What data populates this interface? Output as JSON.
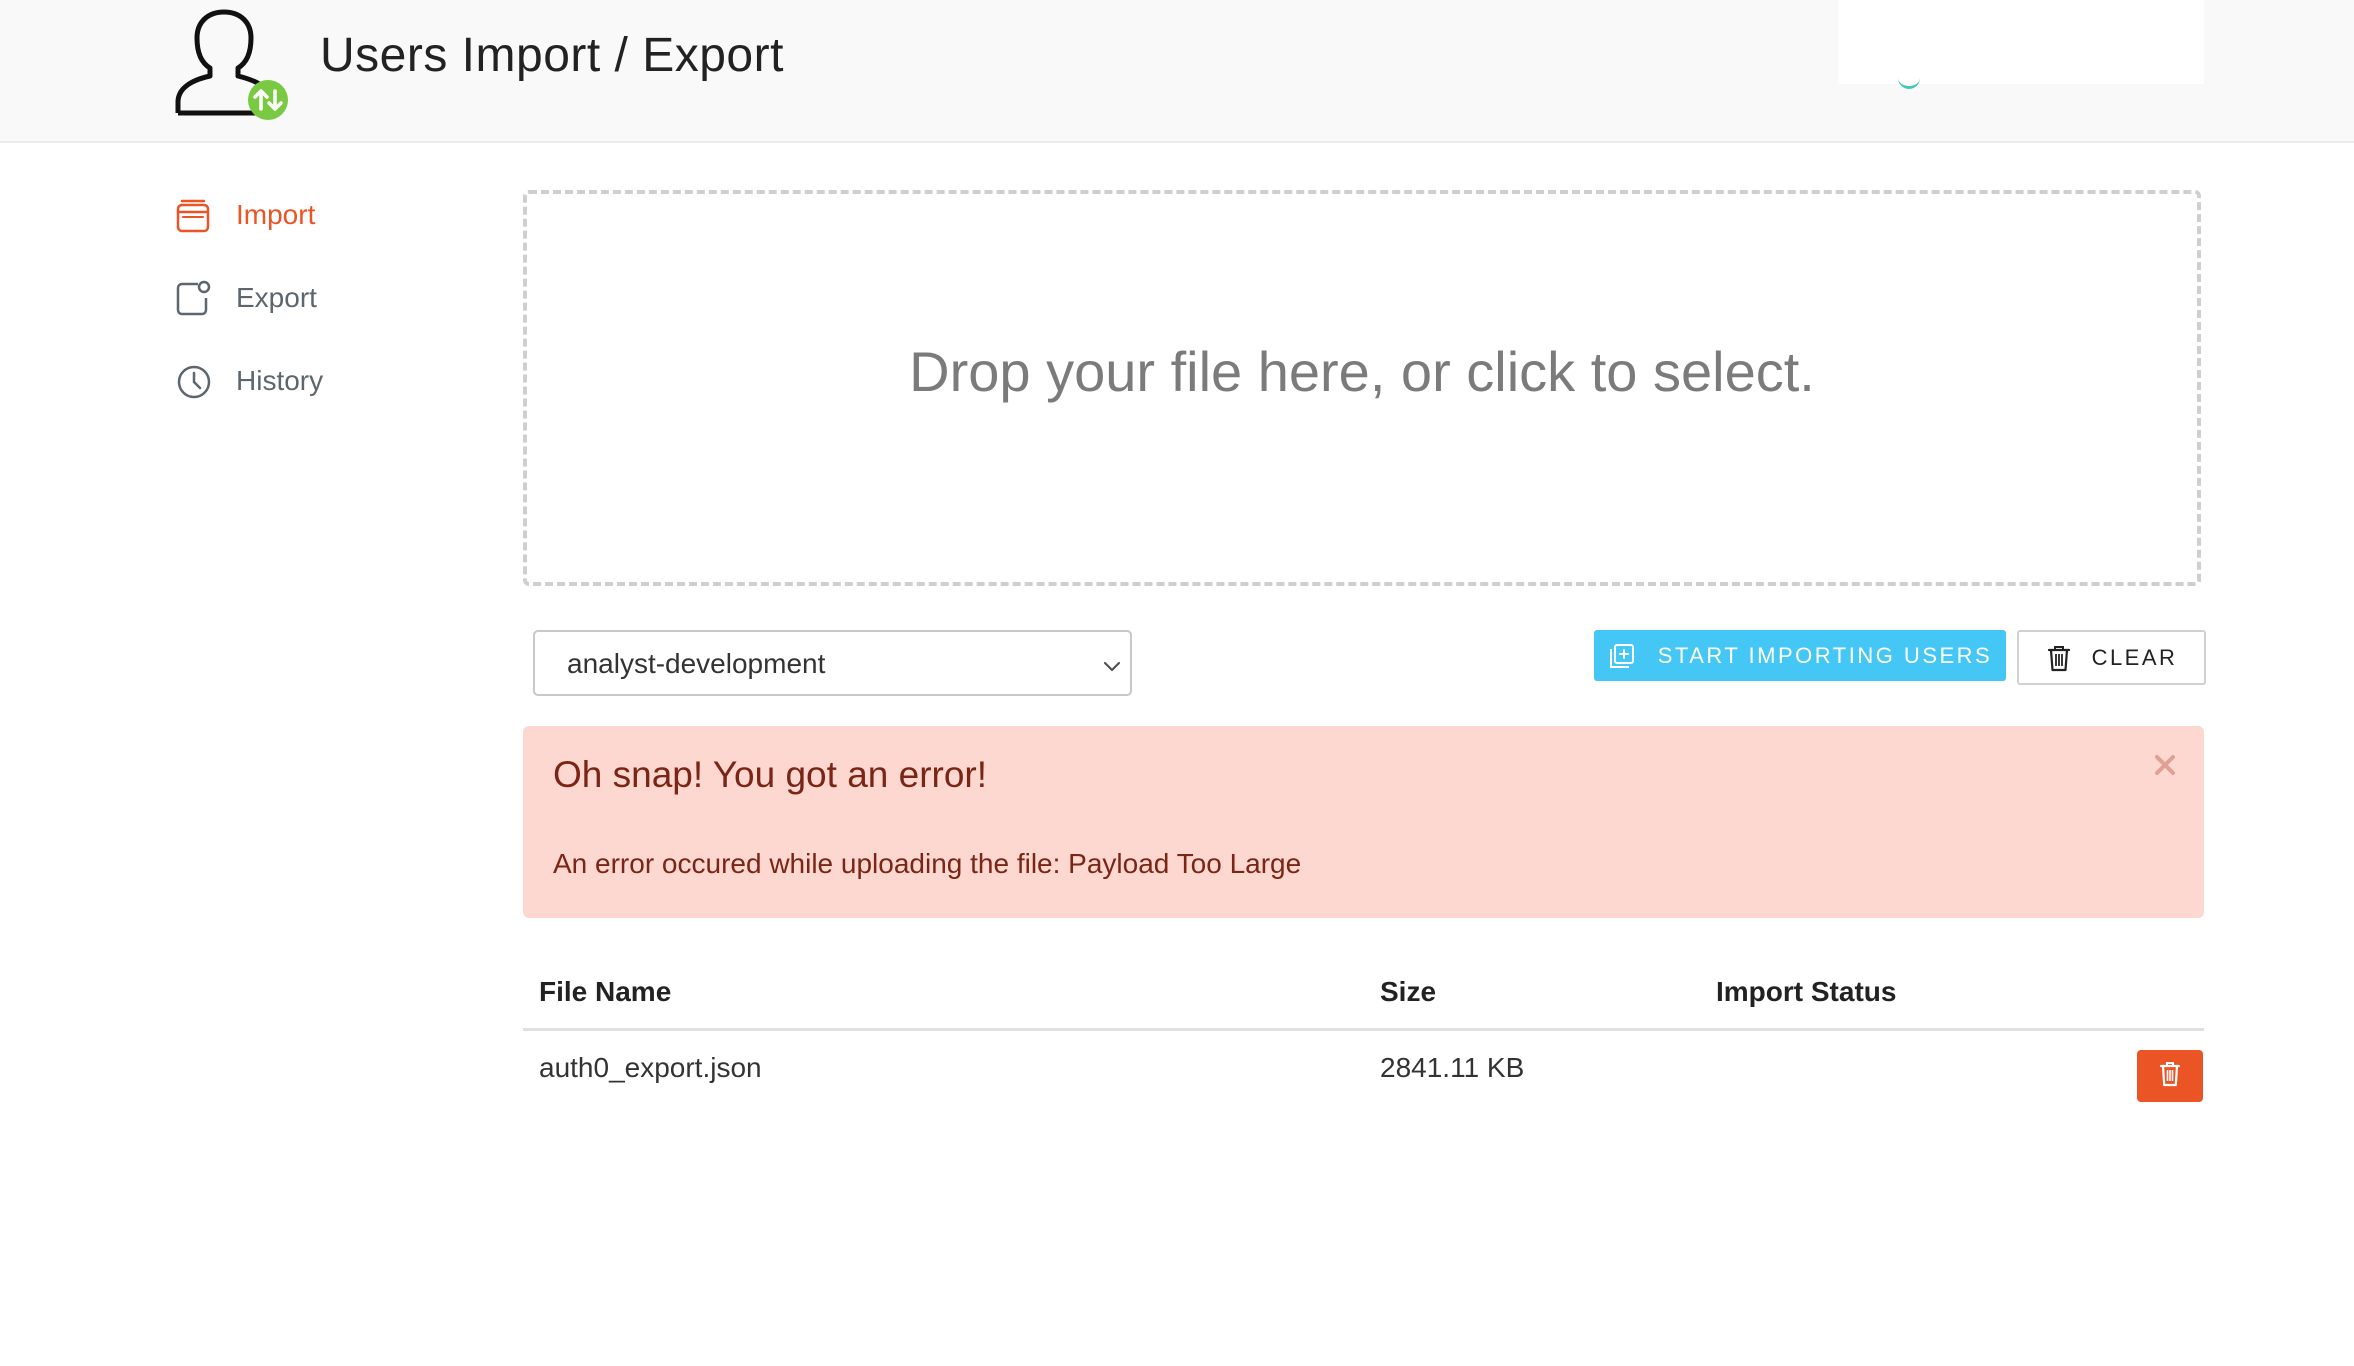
{
  "header": {
    "title": "Users Import / Export",
    "logo_icon": "user-transfer-icon",
    "accent_green": "#7ac943"
  },
  "sidebar": {
    "items": [
      {
        "label": "Import",
        "icon": "import-icon",
        "active": true
      },
      {
        "label": "Export",
        "icon": "export-icon",
        "active": false
      },
      {
        "label": "History",
        "icon": "clock-icon",
        "active": false
      }
    ],
    "active_color": "#eb5424"
  },
  "dropzone": {
    "text": "Drop your file here, or click to select."
  },
  "connection_select": {
    "value": "analyst-development"
  },
  "actions": {
    "start_label": "START IMPORTING USERS",
    "start_color": "#44c7f4",
    "clear_label": "CLEAR"
  },
  "alert": {
    "title": "Oh snap! You got an error!",
    "message": "An error occured while uploading the file: Payload Too Large",
    "background": "#fdd8d0"
  },
  "table": {
    "headers": [
      "File Name",
      "Size",
      "Import Status"
    ],
    "rows": [
      {
        "file_name": "auth0_export.json",
        "size": "2841.11 KB",
        "status": ""
      }
    ]
  }
}
